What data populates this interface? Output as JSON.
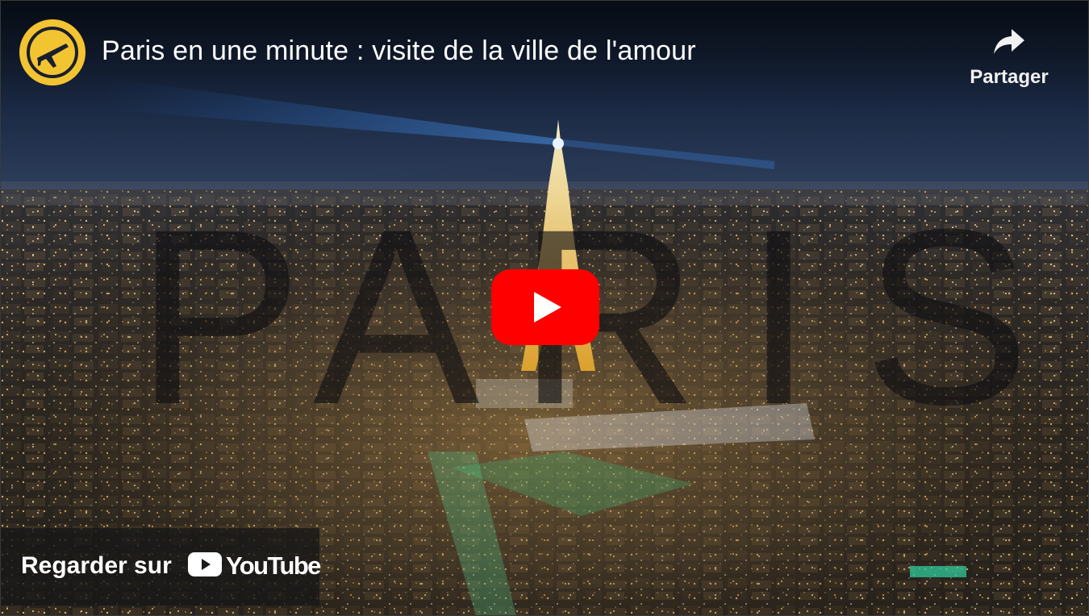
{
  "video": {
    "title": "Paris en une minute : visite de la ville de l'amour",
    "thumbnail_text": "PARIS"
  },
  "channel": {
    "logo_icon": "airplane-icon",
    "logo_color": "#f3c432"
  },
  "share": {
    "label": "Partager",
    "icon": "share-arrow-icon"
  },
  "play_button": {
    "icon": "play-icon",
    "color": "#ff0000"
  },
  "watch_on": {
    "label": "Regarder sur",
    "brand": "YouTube",
    "icon": "youtube-logo-icon"
  }
}
